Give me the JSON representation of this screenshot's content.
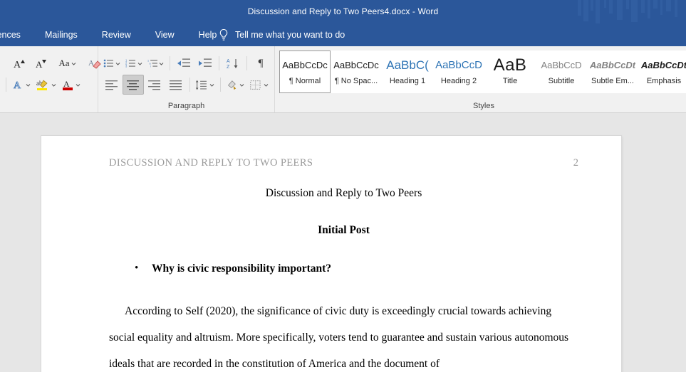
{
  "titlebar": {
    "document_title": "Discussion and Reply to Two Peers4.docx  -  Word"
  },
  "ribbon_tabs": {
    "items": [
      {
        "label": "References",
        "icon": ""
      },
      {
        "label": "Mailings",
        "icon": ""
      },
      {
        "label": "Review",
        "icon": ""
      },
      {
        "label": "View",
        "icon": ""
      },
      {
        "label": "Help",
        "icon": ""
      }
    ],
    "tellme": {
      "icon": "lightbulb-icon",
      "label": "Tell me what you want to do"
    }
  },
  "ribbon": {
    "font_group": {
      "label": "",
      "row1": [
        {
          "name": "grow-font",
          "glyph": "A",
          "sup": "▲"
        },
        {
          "name": "shrink-font",
          "glyph": "A",
          "sup": "▼"
        },
        {
          "name": "change-case",
          "glyph": "Aa"
        },
        {
          "name": "clear-formatting",
          "glyph": "A"
        }
      ],
      "row2": [
        {
          "name": "text-effects",
          "glyph": "A"
        },
        {
          "name": "text-highlight-color",
          "glyph": "ab",
          "color": "#ffe800"
        },
        {
          "name": "font-color",
          "glyph": "A",
          "color": "#cc0000"
        }
      ]
    },
    "paragraph_group": {
      "label": "Paragraph",
      "row1": [
        {
          "name": "bullets"
        },
        {
          "name": "numbering"
        },
        {
          "name": "multilevel-list"
        },
        {
          "name": "decrease-indent"
        },
        {
          "name": "increase-indent"
        },
        {
          "name": "sort",
          "glyph": "A\nZ"
        },
        {
          "name": "show-formatting-marks",
          "glyph": "¶"
        }
      ],
      "row2": [
        {
          "name": "align-left",
          "active": false
        },
        {
          "name": "align-center",
          "active": true
        },
        {
          "name": "align-right",
          "active": false
        },
        {
          "name": "justify",
          "active": false
        },
        {
          "name": "line-spacing"
        },
        {
          "name": "shading"
        },
        {
          "name": "borders"
        }
      ]
    },
    "styles_group": {
      "label": "Styles",
      "items": [
        {
          "preview": "AaBbCcDc",
          "name": "¶ Normal",
          "selected": true,
          "class": ""
        },
        {
          "preview": "AaBbCcDc",
          "name": "¶ No Spac...",
          "selected": false,
          "class": ""
        },
        {
          "preview": "AaBbC(",
          "name": "Heading 1",
          "selected": false,
          "class": "sp-h1"
        },
        {
          "preview": "AaBbCcD",
          "name": "Heading 2",
          "selected": false,
          "class": "sp-h2"
        },
        {
          "preview": "AaB",
          "name": "Title",
          "selected": false,
          "class": "sp-title"
        },
        {
          "preview": "AaBbCcD",
          "name": "Subtitle",
          "selected": false,
          "class": "sp-sub"
        },
        {
          "preview": "AaBbCcDt",
          "name": "Subtle Em...",
          "selected": false,
          "class": "sp-subem"
        },
        {
          "preview": "AaBbCcDt",
          "name": "Emphasis",
          "selected": false,
          "class": "sp-em"
        }
      ]
    }
  },
  "document": {
    "running_header": "DISCUSSION AND REPLY TO TWO PEERS",
    "page_number": "2",
    "title": "Discussion and Reply to Two Peers",
    "section_heading": "Initial Post",
    "bullet_marker": "•",
    "bullet_text": "Why is civic responsibility important?",
    "paragraph": "According to Self (2020), the significance of civic duty is exceedingly crucial towards achieving social equality and altruism. More specifically, voters tend to guarantee and sustain various autonomous ideals that are recorded in the constitution of America and the document of"
  },
  "colors": {
    "word_blue": "#2b579a",
    "ribbon_bg": "#f1f1f1",
    "canvas_gray": "#e6e6e6",
    "heading_blue": "#2e74b5"
  }
}
